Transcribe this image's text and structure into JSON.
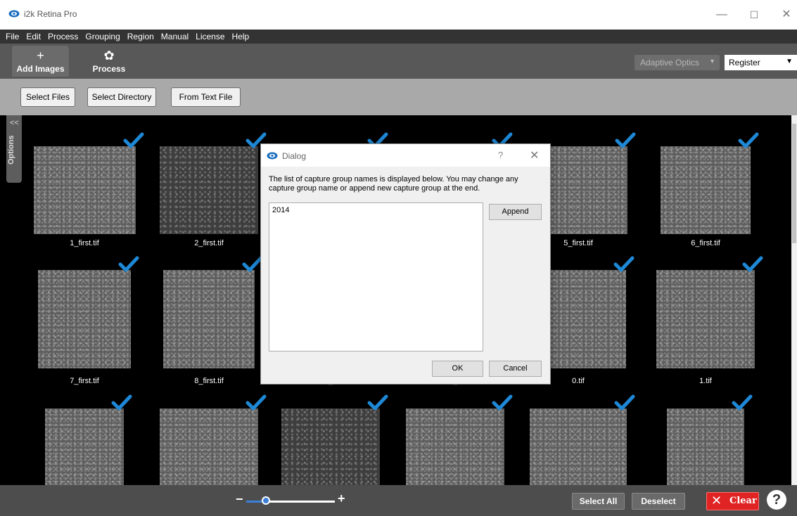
{
  "window": {
    "title": "i2k Retina Pro",
    "min_glyph": "—",
    "max_glyph": "☐",
    "close_glyph": "✕"
  },
  "menu": [
    "File",
    "Edit",
    "Process",
    "Grouping",
    "Region",
    "Manual",
    "License",
    "Help"
  ],
  "toolbar": {
    "add_images_icon": "plus-icon",
    "add_images_glyph": "+",
    "add_images_label": "Add Images",
    "process_icon": "flower-icon",
    "process_glyph": "✿",
    "process_label": "Process",
    "adaptive_optics": "Adaptive Optics",
    "mode_select": "Register"
  },
  "file_buttons": {
    "select_files": "Select Files",
    "select_directory": "Select Directory",
    "from_text_file": "From Text File"
  },
  "options_tab": {
    "label": "Options",
    "chevron": "<<"
  },
  "thumbnails": [
    {
      "name": "1_first.tif",
      "checked": true
    },
    {
      "name": "2_first.tif",
      "checked": true
    },
    {
      "name": "",
      "checked": true
    },
    {
      "name": "",
      "checked": true
    },
    {
      "name": "5_first.tif",
      "checked": true
    },
    {
      "name": "6_first.tif",
      "checked": true
    },
    {
      "name": "7_first.tif",
      "checked": true
    },
    {
      "name": "8_first.tif",
      "checked": true
    },
    {
      "name": "_",
      "checked": true
    },
    {
      "name": "_",
      "checked": true
    },
    {
      "name": "0.tif",
      "checked": true
    },
    {
      "name": "1.tif",
      "checked": true
    },
    {
      "name": "",
      "checked": true
    },
    {
      "name": "",
      "checked": true
    },
    {
      "name": "",
      "checked": true
    },
    {
      "name": "",
      "checked": true
    },
    {
      "name": "",
      "checked": true
    },
    {
      "name": "",
      "checked": true
    }
  ],
  "bottom": {
    "zoom_minus": "−",
    "zoom_plus": "+",
    "zoom_level": 0.22,
    "select_all": "Select All",
    "deselect": "Deselect",
    "clear": "Clear",
    "clear_glyph": "✕",
    "help_glyph": "?"
  },
  "dialog": {
    "title": "Dialog",
    "help_glyph": "?",
    "close_glyph": "✕",
    "message": "The list of capture group names is displayed below. You may change any capture group name or append new capture group at the end.",
    "groups": [
      "2014"
    ],
    "append_label": "Append",
    "ok_label": "OK",
    "cancel_label": "Cancel"
  },
  "colors": {
    "check": "#1e88d6",
    "clear_bg": "#e02424",
    "slider": "#3b7fd9"
  }
}
